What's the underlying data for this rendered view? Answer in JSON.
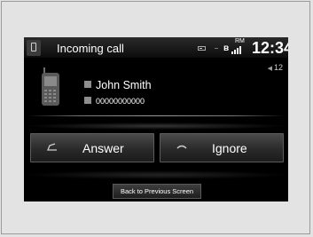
{
  "header": {
    "title": "Incoming call",
    "clock": "12:34",
    "rm_label": "RM",
    "message_count": "12"
  },
  "caller": {
    "name": "John Smith",
    "number": "00000000000"
  },
  "buttons": {
    "answer_label": "Answer",
    "ignore_label": "Ignore",
    "back_label": "Back to Previous Screen"
  },
  "colors": {
    "screen_bg": "#000000",
    "text": "#ffffff",
    "page_bg": "#e3e3e3"
  },
  "icons": [
    "phone-tab-icon",
    "battery-icon",
    "bluetooth-icon",
    "signal-icon",
    "handset-icon",
    "contact-icon",
    "number-icon",
    "answer-icon",
    "ignore-icon"
  ]
}
